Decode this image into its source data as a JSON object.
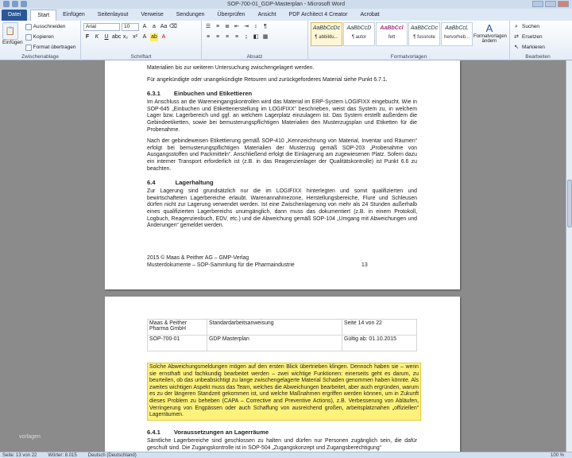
{
  "window": {
    "title": "SOP-700-01_GDP-Masterplan - Microsoft Word"
  },
  "tabs": [
    {
      "label": "Datei"
    },
    {
      "label": "Start"
    },
    {
      "label": "Einfügen"
    },
    {
      "label": "Seitenlayout"
    },
    {
      "label": "Verweise"
    },
    {
      "label": "Sendungen"
    },
    {
      "label": "Überprüfen"
    },
    {
      "label": "Ansicht"
    },
    {
      "label": "PDF Architect 4 Creator"
    },
    {
      "label": "Acrobat"
    }
  ],
  "ribbon": {
    "clipboard": {
      "paste": "Einfügen",
      "cut": "Ausschneiden",
      "copy": "Kopieren",
      "format_painter": "Format übertragen",
      "label": "Zwischenablage"
    },
    "font": {
      "name": "Arial",
      "size": "10",
      "label": "Schriftart"
    },
    "paragraph": {
      "label": "Absatz"
    },
    "styles": {
      "items": [
        {
          "preview": "AaBbCcDc",
          "name": "¶ abbildu..."
        },
        {
          "preview": "AaBbCcD",
          "name": "¶ autor"
        },
        {
          "preview": "AaBbCcl",
          "name": "fett"
        },
        {
          "preview": "AaBbCcDc",
          "name": "¶ fussnote"
        },
        {
          "preview": "AaBbCcL",
          "name": "hervorheb..."
        }
      ],
      "change": "Formatvorlagen ändern",
      "label": "Formatvorlagen"
    },
    "editing": {
      "find": "Suchen",
      "replace": "Ersetzen",
      "select": "Markieren",
      "label": "Bearbeiten"
    }
  },
  "page1": {
    "top_partial": "Materialien bis zur weiteren Untersuchung zwischengelagert werden.",
    "para_retouren": "Für angekündigte oder unangekündigte Retouren und zurückgeforderes Material siehe Punkt 6.7.1.",
    "h631_num": "6.3.1",
    "h631_title": "Einbuchen und Etikettieren",
    "p631a": "Im Anschluss an die Wareneingangskontrollen wird das Material im ERP-System LOGIFIXX eingebucht. Wie in SOP-645 „Einbuchen und Etikettenerstellung im LOGIFIXX“ beschrieben, weist das System zu, in welchem Lager bzw. Lagerbereich und ggf. an welchem Lagerplatz einzulagern ist. Das System erstellt außerdem die Gebindeetiketten, sowie bei bemusterungspflichtigen Materialien den Musterzugsplan und Etiketten für die Probenahme.",
    "p631b": "Nach der gebindeweisen Etikettierung gemäß SOP-410 „Kennzeichnung von Material, Inventar und Räumen“ erfolgt bei bemusterungspflichtigen Materialien der Musterzug gemäß SOP-203 „Probenahme von Ausgangsstoffen und Packmitteln“. Anschließend erfolgt die Einlagerung am zugewiesenen Platz. Sofern dazu ein interner Transport erforderlich ist (z.B. in das Reagenzienlager der Qualitätskontrolle) ist Punkt 6.6 zu beachten.",
    "h64_num": "6.4",
    "h64_title": "Lagerhaltung",
    "p64": "Zur Lagerung sind grundsätzlich nur die im LOGIFIXX hinterlegten und somit qualifizierten und bewirtschafteten Lagerbereiche erlaubt. Warenannahmezone, Herstellungsbereiche, Flure und Schleusen dürfen nicht zur Lagerung verwendet werden. Ist eine Zwischenlagerung von mehr als 24 Stunden außerhalb eines qualifizierten Lagerbereichs unumgänglich, dann muss das dokumentiert (z.B. in einem Protokoll, Logbuch, Reagenzienbuch, EDV, etc.) und die Abweichung gemäß SOP-104 „Umgang mit Abweichungen und Änderungen“ gemeldet werden.",
    "footer_line1": "2015 © Maas & Peither AG – GMP-Verlag",
    "footer_line2": "Musterdokumente – SOP-Sammlung für die Pharmaindustrie",
    "page_number": "13"
  },
  "page2": {
    "table": {
      "r1c1": "Maas & Peither Pharma GmbH",
      "r1c2": "Standardarbeitsanweisung",
      "r1c3": "Seite 14 von 22",
      "r2c1": "SOP-700-01",
      "r2c2": "GDP Masterplan",
      "r2c3": "Gültig ab: 01.10.2015"
    },
    "highlight": "Solche Abweichungsmeldungen mögen auf den ersten Blick übertrieben klingen. Dennoch haben sie – wenn sie ernsthaft und fachkundig bearbeitet werden – zwei wichtige Funktionen: einerseits geht es darum, zu beurteilen, ob das unbeabsichtigt zu lange zwischengelagerte Material Schaden genommen haben könnte. Als zweites wichtigen Aspekt muss das Team, welches die Abweichungen bearbeitet, aber auch ergründen, warum es zu der längeren Standzeit gekommen ist, und welche Maßnahmen ergriffen werden können, um in Zukunft dieses Problem zu beheben (CAPA – Corrective and Preventive Actions), z.B. Verbesserung von Abläufen, Verringerung von Engpässen oder auch Schaffung von ausreichend großen, arbeitsplatznahen „offiziellen“ Lagerräumen.",
    "h641_num": "6.4.1",
    "h641_title": "Voraussetzungen an Lagerräume",
    "p641": "Sämtliche Lagerbereiche sind geschlossen zu halten und dürfen nur Personen zugänglich sein, die dafür geschult sind. Die Zugangskontrolle ist in SOP-504 „Zugangskonzept und Zugangsberechtigung“"
  },
  "status": {
    "page": "Seite: 13 von 22",
    "words": "Wörter: 8.015",
    "language": "Deutsch (Deutschland)",
    "zoom": "100 %"
  },
  "watermark": "vorlagen"
}
